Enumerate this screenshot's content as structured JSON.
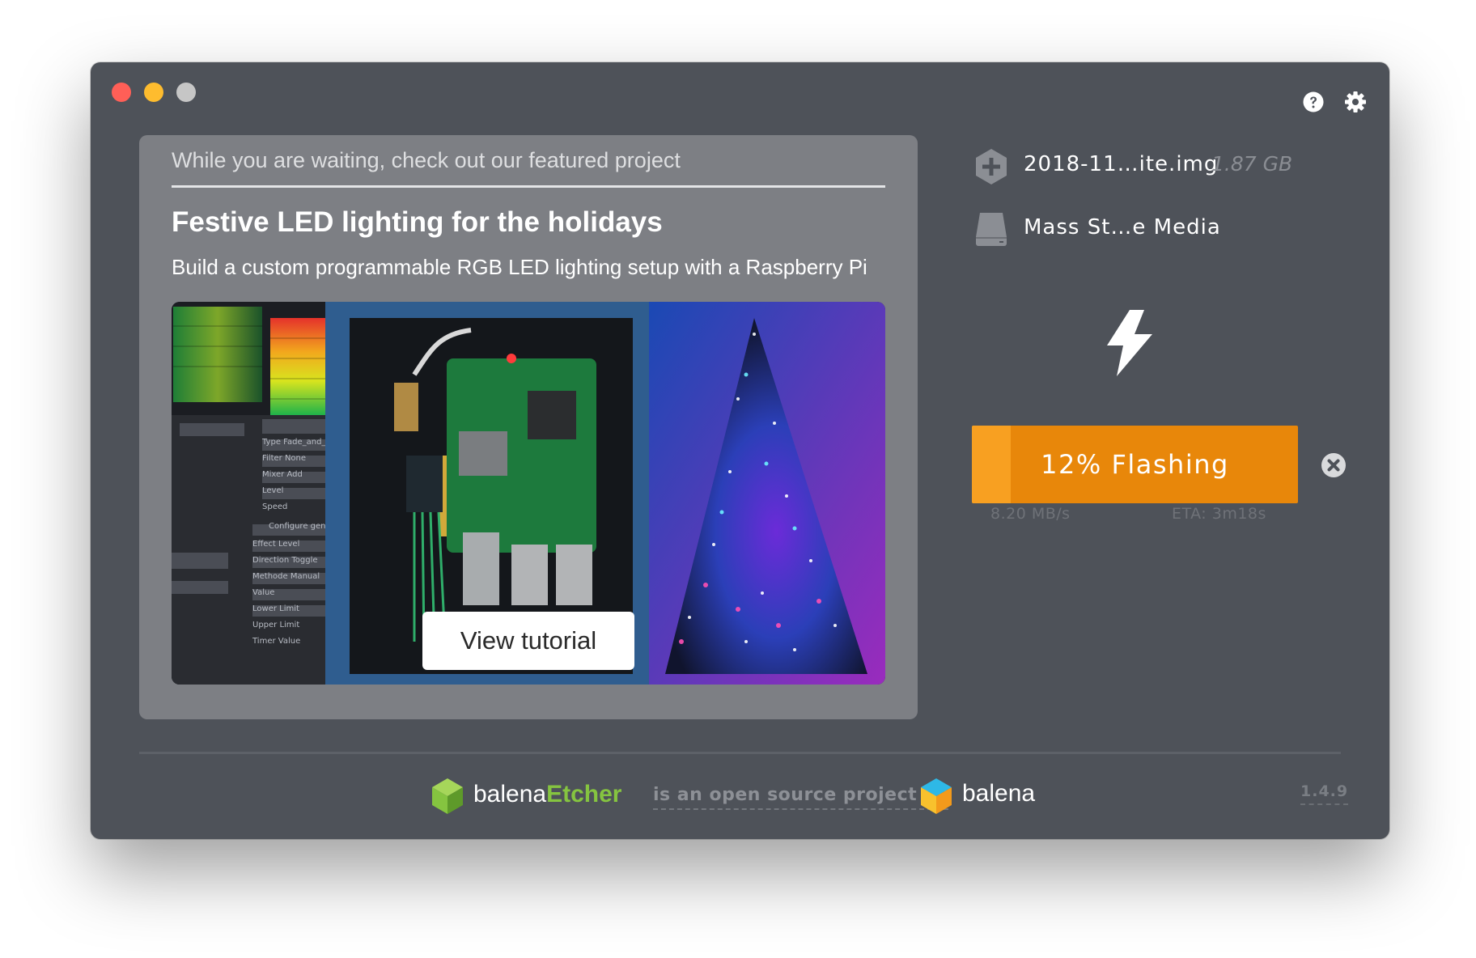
{
  "window": {
    "buttons": {
      "close": "close-window",
      "minimize": "minimize-window",
      "maximize": "maximize-window"
    },
    "header_icons": [
      "help-icon",
      "settings-gear-icon"
    ]
  },
  "featured": {
    "tagline": "While you are waiting, check out our featured project",
    "title": "Festive LED lighting for the holidays",
    "description": "Build a custom programmable RGB LED lighting setup with a Raspberry Pi",
    "button_label": "View tutorial"
  },
  "source": {
    "icon": "image-source-plus-icon",
    "filename": "2018-11…ite.img",
    "size": "1.87 GB"
  },
  "target": {
    "icon": "drive-icon",
    "name": "Mass St…e Media"
  },
  "flash": {
    "icon": "lightning-bolt-icon",
    "progress_percent": 12,
    "label": "12% Flashing",
    "speed": "8.20 MB/s",
    "eta": "ETA: 3m18s",
    "cancel_icon": "cancel-icon"
  },
  "footer": {
    "etcher_prefix": "balena",
    "etcher_suffix": "Etcher",
    "opensource_text": "is an open source project by",
    "balena_name": "balena",
    "version": "1.4.9"
  },
  "colors": {
    "window_bg": "#4e5259",
    "card_bg": "#7d7f84",
    "progress_bg": "#e8870a",
    "progress_fill": "#f8a021",
    "etcher_green": "#85c440"
  }
}
